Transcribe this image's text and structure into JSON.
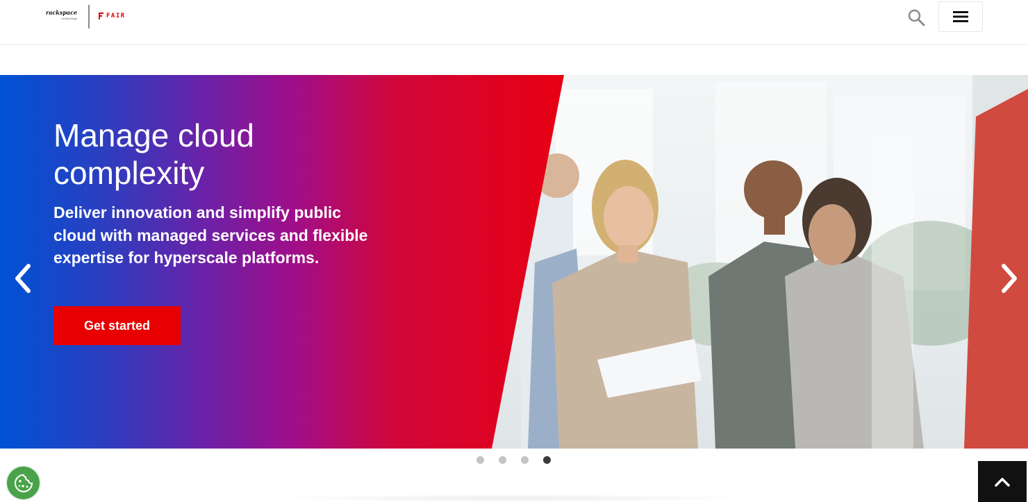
{
  "header": {
    "logo_rackspace": "rackspace",
    "logo_rackspace_sub": "technology",
    "logo_fair": "FAIR"
  },
  "hero": {
    "title": "Manage cloud complexity",
    "subtitle": "Deliver innovation and simplify public cloud with managed services and flexible expertise for hyperscale platforms.",
    "cta_label": "Get started"
  },
  "carousel": {
    "slide_count": 4,
    "active_index": 3
  },
  "icons": {
    "search": "search-icon",
    "menu": "hamburger-menu-icon",
    "prev": "chevron-left-icon",
    "next": "chevron-right-icon",
    "cookie": "cookie-icon",
    "scroll_top": "chevron-up-icon"
  },
  "colors": {
    "brand_red": "#e80000",
    "gradient_blue": "#0052d4",
    "gradient_purple": "#a00e8a",
    "cookie_green": "#4aa34a"
  }
}
